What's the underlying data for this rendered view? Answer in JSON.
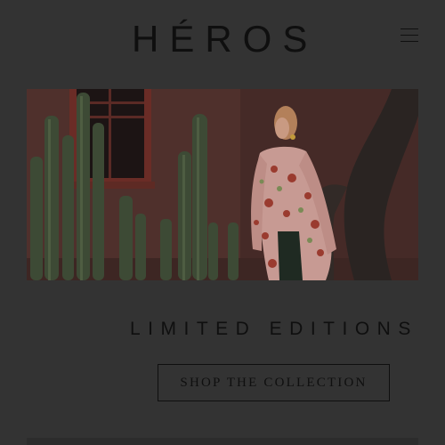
{
  "header": {
    "logo_text": "HÉROS",
    "menu_icon": "hamburger-menu-icon"
  },
  "hero": {
    "image_alt": "Model in floral shirt standing among tall cacti beside a tree trunk"
  },
  "promo": {
    "headline": "LIMITED EDITIONS",
    "cta_label": "SHOP THE COLLECTION"
  },
  "colors": {
    "overlay_background": "#333333",
    "text": "#0f0f0f",
    "hero_wall": "#5a3530"
  }
}
